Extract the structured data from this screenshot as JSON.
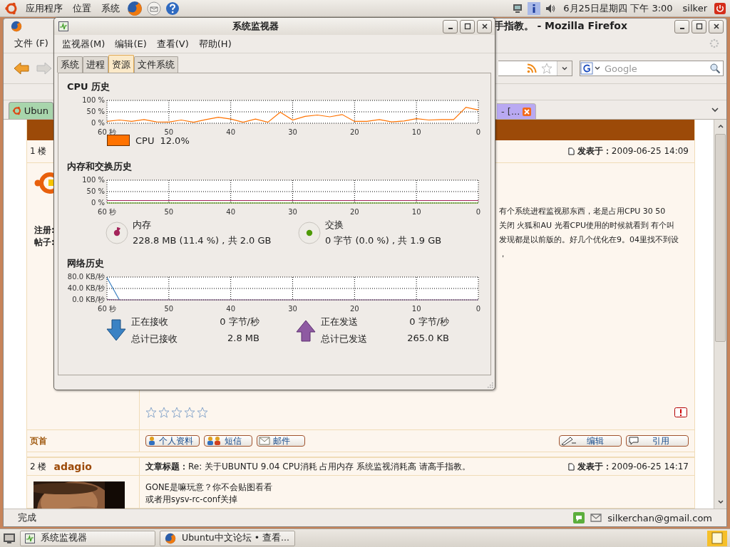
{
  "top_panel": {
    "menus": [
      "应用程序",
      "位置",
      "系统"
    ],
    "clock": "6月25日星期四 下午 3:00",
    "user": "silker"
  },
  "firefox": {
    "title": "手指教。 - Mozilla Firefox",
    "menu": [
      "文件 (F)"
    ],
    "search": {
      "placeholder": "Google"
    },
    "tabs": [
      {
        "label": "Ubun",
        "selected": true,
        "color": "#a8d5ac"
      },
      {
        "label": "- [...",
        "selected": false,
        "color": "#b9a9f2"
      }
    ],
    "posts": [
      {
        "floor": "1 楼",
        "posted": "**发表于：**2009-06-25 14:09",
        "info": [
          "注册:",
          "帖子:"
        ],
        "body": [
          "有个系统进程监视那东西，老是占用CPU 30 50",
          "关闭 火狐和AU 光看CPU使用的时候就看到 有个叫",
          "发现都是以前版的。好几个优化在9。04里找不到设",
          "，"
        ],
        "stars": 0,
        "top_link": "页首",
        "buttons": [
          {
            "kind": "profile",
            "label": "个人资料"
          },
          {
            "kind": "pm",
            "label": "短信"
          },
          {
            "kind": "mail",
            "label": "邮件"
          }
        ],
        "actions": [
          {
            "kind": "edit",
            "label": "编辑"
          },
          {
            "kind": "quote",
            "label": "引用"
          }
        ]
      },
      {
        "floor": "2 楼",
        "author": "adagio",
        "subject": "**文章标题：**Re: 关于UBUNTU 9.04 CPU消耗 占用内存 系统监视消耗高 请高手指教。",
        "posted": "**发表于：**2009-06-25 14:17",
        "avatar": {
          "kind": "picture"
        },
        "body": [
          "GONE是嘛玩意？你不会贴图看看",
          "或者用sysv-rc-conf关掉"
        ]
      }
    ],
    "status": "完成",
    "email": "silkerchan@gmail.com"
  },
  "monitor": {
    "title": "系统监视器",
    "menus": [
      "监视器(M)",
      "编辑(E)",
      "查看(V)",
      "帮助(H)"
    ],
    "tabs": [
      {
        "label": "系统",
        "selected": false
      },
      {
        "label": "进程",
        "selected": false
      },
      {
        "label": "资源",
        "selected": true
      },
      {
        "label": "文件系统",
        "selected": false
      }
    ],
    "cpu": {
      "heading": "CPU 历史",
      "chart_data": {
        "type": "line",
        "grid": true,
        "x": [
          60,
          58,
          56,
          54,
          52,
          50,
          48,
          46,
          44,
          42,
          40,
          38,
          36,
          34,
          32,
          30,
          28,
          26,
          24,
          22,
          20,
          18,
          16,
          14,
          12,
          10,
          8,
          6,
          4,
          2,
          0
        ],
        "xlim": [
          60,
          0
        ],
        "ylim": [
          0,
          100
        ],
        "xticks": [
          {
            "value": 60,
            "label": "60 秒"
          },
          50,
          40,
          30,
          20,
          10,
          0
        ],
        "yticks": [
          {
            "value": 0,
            "label": "0 %"
          },
          {
            "value": 50,
            "label": "50 %"
          },
          {
            "value": 100,
            "label": "100 %"
          }
        ],
        "series": [
          {
            "color": "#ff7200",
            "values": [
              8,
              14,
              8,
              16,
              6,
              5,
              14,
              4,
              16,
              26,
              18,
              4,
              18,
              4,
              48,
              14,
              30,
              36,
              28,
              38,
              8,
              8,
              16,
              6,
              10,
              20,
              14,
              16,
              16,
              70,
              58
            ]
          }
        ]
      },
      "legend": [
        {
          "label": "CPU",
          "value": "12.0%",
          "color": "#ff7200"
        }
      ]
    },
    "memory": {
      "heading": "内存和交换历史",
      "chart_data": {
        "type": "line",
        "grid": true,
        "x": [
          60,
          0
        ],
        "xlim": [
          60,
          0
        ],
        "ylim": [
          0,
          100
        ],
        "xticks": [
          {
            "value": 60,
            "label": "60 秒"
          },
          50,
          40,
          30,
          20,
          10,
          0
        ],
        "yticks": [
          {
            "value": 0,
            "label": "0 %"
          },
          {
            "value": 50,
            "label": "50 %"
          },
          {
            "value": 100,
            "label": "100 %"
          }
        ],
        "series": [
          {
            "color": "#a4245a",
            "values": [
              11,
              11
            ]
          },
          {
            "color": "#4e9a06",
            "values": [
              0,
              0
            ]
          }
        ]
      },
      "legend": [
        {
          "label": "内存",
          "detail": "228.8 MB (11.4 %) , 共 2.0 GB",
          "color": "#a4245a"
        },
        {
          "label": "交换",
          "detail": "0 字节 (0.0 %) , 共 1.9 GB",
          "color": "#4e9a06"
        }
      ]
    },
    "network": {
      "heading": "网络历史",
      "chart_data": {
        "type": "line",
        "grid": true,
        "x": [
          60,
          58,
          56,
          54,
          52,
          50,
          40,
          30,
          20,
          10,
          0
        ],
        "xlim": [
          60,
          0
        ],
        "ylim": [
          0,
          80
        ],
        "xticks": [
          {
            "value": 60,
            "label": "60 秒"
          },
          50,
          40,
          30,
          20,
          10,
          0
        ],
        "yticks": [
          {
            "value": 0,
            "label": "0.0 KB/秒"
          },
          {
            "value": 40,
            "label": "40.0 KB/秒"
          },
          {
            "value": 80,
            "label": "80.0 KB/秒"
          }
        ],
        "series": [
          {
            "color": "#3a7fc0",
            "values": [
              78,
              0,
              null,
              null,
              null,
              null,
              null,
              null,
              null,
              null,
              null
            ]
          },
          {
            "color": "#75507b",
            "values": [
              1,
              0,
              0,
              0,
              0,
              0,
              0,
              0,
              0,
              0,
              0
            ]
          }
        ]
      },
      "stats": [
        {
          "kind": "down",
          "rate_label": "正在接收",
          "rate": "0 字节/秒",
          "total_label": "总计已接收",
          "total": "2.8 MB"
        },
        {
          "kind": "up",
          "rate_label": "正在发送",
          "rate": "0 字节/秒",
          "total_label": "总计已发送",
          "total": "265.0 KB"
        }
      ]
    }
  },
  "taskbar": {
    "tasks": [
      {
        "kind": "monitor",
        "label": "系统监视器",
        "selected": false
      },
      {
        "kind": "browser",
        "label": "Ubuntu中文论坛 • 查看...",
        "selected": false
      }
    ]
  }
}
